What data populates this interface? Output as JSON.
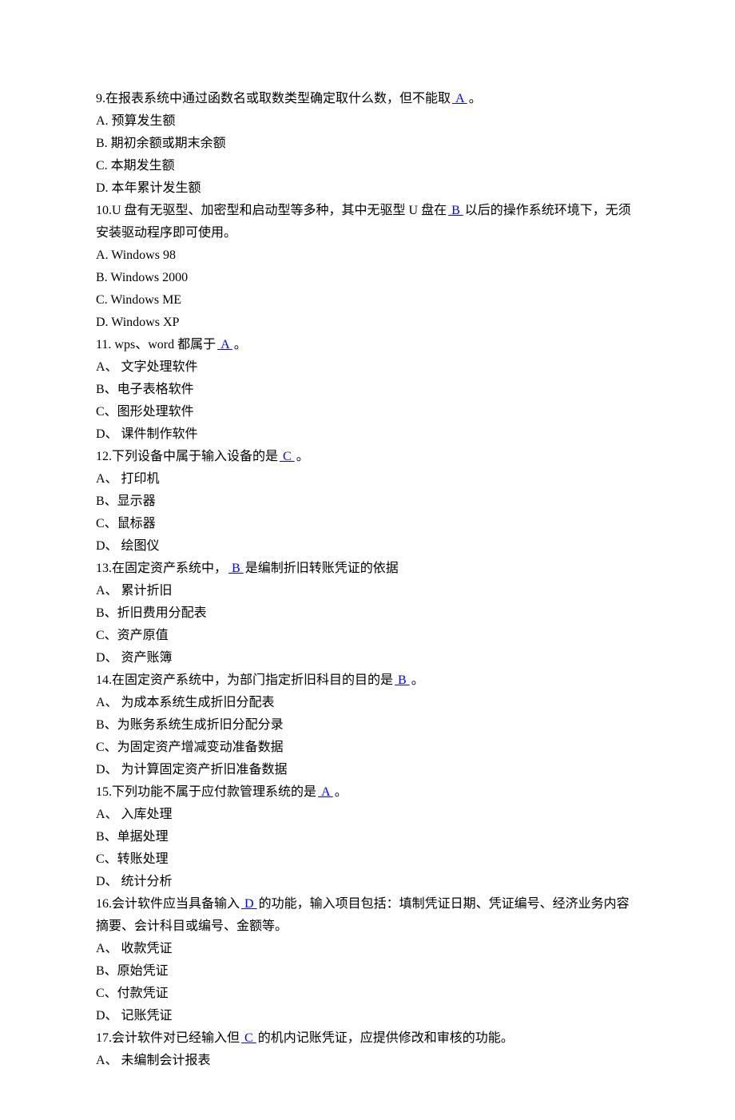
{
  "questions": [
    {
      "num": "9",
      "stem_before": ".在报表系统中通过函数名或取数类型确定取什么数，但不能取",
      "answer": "   A   ",
      "stem_after": "。",
      "options": [
        "A.  预算发生额",
        "B.  期初余额或期末余额",
        "C.  本期发生额",
        "D.  本年累计发生额"
      ]
    },
    {
      "num": "10",
      "stem_before": ".U 盘有无驱型、加密型和启动型等多种，其中无驱型 U 盘在",
      "answer": "   B   ",
      "stem_after": "以后的操作系统环境下，无须安装驱动程序即可使用。",
      "options": [
        "A. Windows 98",
        "B. Windows 2000",
        "C. Windows ME",
        "D. Windows XP"
      ]
    },
    {
      "num": "11",
      "stem_before": ". wps、word 都属于",
      "answer": "    A    ",
      "stem_after": "。",
      "options": [
        "A、 文字处理软件",
        "B、电子表格软件",
        "C、图形处理软件",
        "D、 课件制作软件"
      ]
    },
    {
      "num": "12",
      "stem_before": ".下列设备中属于输入设备的是",
      "answer": "    C     ",
      "stem_after": "。",
      "options": [
        "A、 打印机",
        "B、显示器",
        "C、鼠标器",
        "D、 绘图仪"
      ]
    },
    {
      "num": "13",
      "stem_before": ".在固定资产系统中，",
      "answer": "   B    ",
      "stem_after": "是编制折旧转账凭证的依据",
      "options": [
        "A、 累计折旧",
        "B、折旧费用分配表",
        "C、资产原值",
        "D、 资产账簿"
      ]
    },
    {
      "num": "14",
      "stem_before": ".在固定资产系统中，为部门指定折旧科目的目的是",
      "answer": "   B   ",
      "stem_after": "。",
      "options": [
        "A、 为成本系统生成折旧分配表",
        "B、为账务系统生成折旧分配分录",
        "C、为固定资产增减变动准备数据",
        "D、 为计算固定资产折旧准备数据"
      ]
    },
    {
      "num": "15",
      "stem_before": ".下列功能不属于应付款管理系统的是",
      "answer": "   A    ",
      "stem_after": "。",
      "options": [
        "A、 入库处理",
        "B、单据处理",
        "C、转账处理",
        "D、 统计分析"
      ]
    },
    {
      "num": "16",
      "stem_before": ".会计软件应当具备输入",
      "answer": "   D   ",
      "stem_after": "的功能，输入项目包括：填制凭证日期、凭证编号、经济业务内容摘要、会计科目或编号、金额等。",
      "options": [
        "A、 收款凭证",
        "B、原始凭证",
        "C、付款凭证",
        "D、 记账凭证"
      ]
    },
    {
      "num": "17",
      "stem_before": ".会计软件对已经输入但",
      "answer": "   C    ",
      "stem_after": "的机内记账凭证，应提供修改和审核的功能。",
      "options": [
        "A、 未编制会计报表"
      ]
    }
  ]
}
